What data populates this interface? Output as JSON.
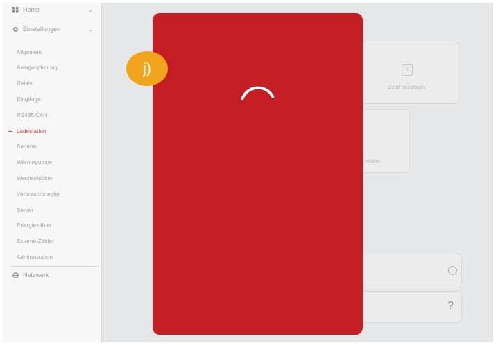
{
  "sidebar": {
    "home": {
      "label": "Home",
      "icon": "grid-icon"
    },
    "settings": {
      "label": "Einstellungen",
      "icon": "gear-icon"
    },
    "items": [
      {
        "label": "Allgemein",
        "active": false
      },
      {
        "label": "Anlagenplanung",
        "active": false
      },
      {
        "label": "Relais",
        "active": false
      },
      {
        "label": "Eingänge",
        "active": false
      },
      {
        "label": "RS485/CAN",
        "active": false
      },
      {
        "label": "Ladestation",
        "active": true
      },
      {
        "label": "Batterie",
        "active": false
      },
      {
        "label": "Wärmepumpe",
        "active": false
      },
      {
        "label": "Wechselrichter",
        "active": false
      },
      {
        "label": "Verbrauchsregler",
        "active": false
      },
      {
        "label": "Server",
        "active": false
      },
      {
        "label": "Energiezähler",
        "active": false
      },
      {
        "label": "Externe Zähler",
        "active": false
      },
      {
        "label": "Administration",
        "active": false
      }
    ],
    "network": {
      "label": "Netzwerk",
      "icon": "globe-icon"
    }
  },
  "main": {
    "add_card_label": "Gerät hinzufügen",
    "second_card_label": "...eckern",
    "help_symbol": "?"
  },
  "modal": {
    "badge_label": "j)",
    "colors": {
      "modal": "#c41e24",
      "badge": "#f2a51c",
      "accent": "#d0453f"
    }
  }
}
